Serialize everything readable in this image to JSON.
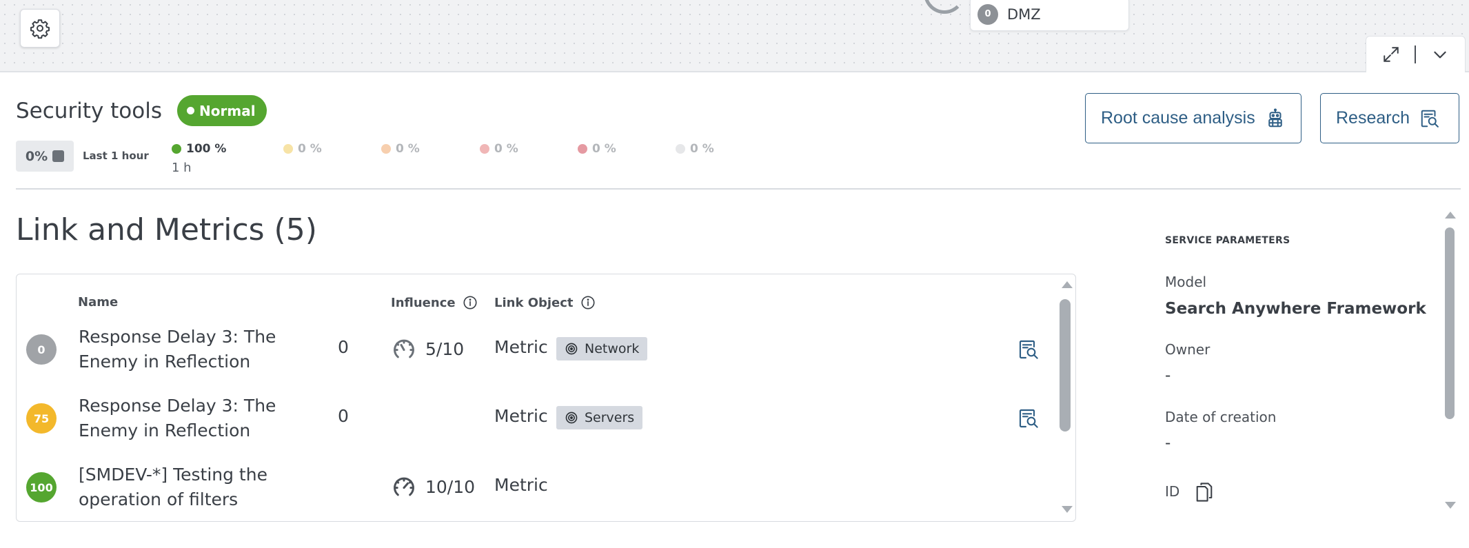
{
  "canvas": {
    "node_label": "DMZ",
    "node_badge": "0"
  },
  "header": {
    "title": "Security tools",
    "status": "Normal",
    "status_color": "#55a630",
    "period_value": "0%",
    "period_label": "Last 1 hour",
    "distribution": [
      {
        "value": "100 %",
        "color": "#55a630",
        "sub": "1 h"
      },
      {
        "value": "0 %",
        "color": "#f7e3a6"
      },
      {
        "value": "0 %",
        "color": "#f7cfae"
      },
      {
        "value": "0 %",
        "color": "#f0b6b6"
      },
      {
        "value": "0 %",
        "color": "#e59aa2"
      },
      {
        "value": "0 %",
        "color": "#e6e7e9"
      }
    ],
    "buttons": {
      "root_cause": "Root cause analysis",
      "research": "Research"
    }
  },
  "links": {
    "title": "Link and Metrics (5)",
    "columns": {
      "name": "Name",
      "influence": "Influence",
      "link_object": "Link Object"
    },
    "rows": [
      {
        "badge": "0",
        "badge_color": "#a0a3a7",
        "name": "Response Delay 3: The Enemy in Reflection",
        "count": "0",
        "influence": "5/10",
        "type": "Metric",
        "tag": "Network",
        "has_research": true
      },
      {
        "badge": "75",
        "badge_color": "#f3b82b",
        "name": "Response Delay 3: The Enemy in Reflection",
        "count": "0",
        "influence": "",
        "type": "Metric",
        "tag": "Servers",
        "has_research": true
      },
      {
        "badge": "100",
        "badge_color": "#55a630",
        "name": "[SMDEV-*] Testing the operation of filters",
        "count": "",
        "influence": "10/10",
        "type": "Metric",
        "tag": "",
        "has_research": false
      }
    ]
  },
  "service_parameters": {
    "heading": "SERVICE PARAMETERS",
    "model_label": "Model",
    "model_value": "Search Anywhere Framework",
    "owner_label": "Owner",
    "owner_value": "-",
    "date_label": "Date of creation",
    "date_value": "-",
    "id_label": "ID"
  }
}
